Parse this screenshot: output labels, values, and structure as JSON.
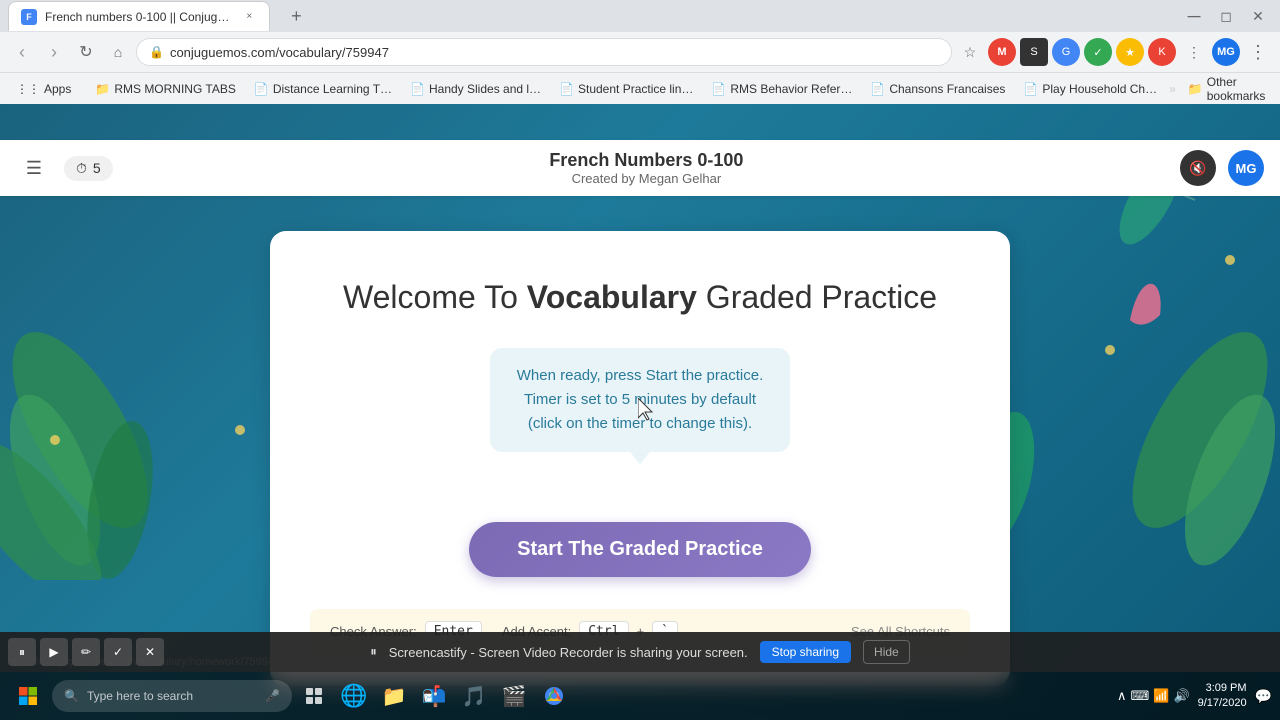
{
  "browser": {
    "tab": {
      "favicon_color": "#4285f4",
      "title": "French numbers 0-100 || Conjug…",
      "close": "×"
    },
    "address": "conjuguemos.com/vocabulary/759947",
    "new_tab_symbol": "+",
    "nav": {
      "back": "‹",
      "forward": "›",
      "refresh": "↻",
      "home": "⌂"
    }
  },
  "bookmarks": [
    {
      "label": "Apps",
      "icon": "⋮⋮"
    },
    {
      "label": "RMS MORNING TABS",
      "icon": "📁"
    },
    {
      "label": "Distance Learning T…",
      "icon": "📄"
    },
    {
      "label": "Handy Slides and l…",
      "icon": "📄"
    },
    {
      "label": "Student Practice lin…",
      "icon": "📄"
    },
    {
      "label": "RMS Behavior Refer…",
      "icon": "📄"
    },
    {
      "label": "Chansons Francaises",
      "icon": "📄"
    },
    {
      "label": "Play Household Ch…",
      "icon": "📄"
    },
    {
      "label": "Other bookmarks",
      "icon": "📁"
    }
  ],
  "app_header": {
    "title": "French Numbers 0-100",
    "subtitle": "Created by Megan Gelhar",
    "timer_icon": "⏱",
    "timer_value": "5",
    "mute_icon": "🔇",
    "user_initials": "MG"
  },
  "card": {
    "welcome_text_pre": "Welcome To ",
    "welcome_bold": "Vocabulary",
    "welcome_text_post": " Graded Practice",
    "info_text_line1": "When ready, press Start the practice.",
    "info_text_line2": "Timer is set to 5 minutes by default",
    "info_text_line3": "(click on the timer to change this).",
    "start_button": "Start The Graded Practice",
    "shortcuts": {
      "check_label": "Check Answer:",
      "check_key": "Enter",
      "accent_label": "Add Accent:",
      "ctrl_key": "Ctrl",
      "plus": "+",
      "accent_key": "`",
      "see_all": "See All Shortcuts"
    }
  },
  "screencast": {
    "icon": "⏸",
    "message": "Screencastify - Screen Video Recorder is sharing your screen.",
    "stop_label": "Stop sharing",
    "hide_label": "Hide"
  },
  "taskbar": {
    "start_icon": "⊞",
    "search_placeholder": "Type here to search",
    "search_icon": "🔍",
    "mic_icon": "🎤",
    "icons": [
      "⊟",
      "🌐",
      "📁",
      "📬",
      "🎵",
      "🌀"
    ],
    "sys_icons": [
      "∧",
      "⌨",
      "📶",
      "🔊"
    ],
    "time": "3:09 PM",
    "date": "9/17/2020",
    "status_url": "https://conjuguemos.com/vocabulary/homework/759947"
  },
  "recording_controls": {
    "pause": "⏸",
    "play": "▶",
    "pencil": "✏",
    "check": "✓",
    "close": "✕"
  }
}
